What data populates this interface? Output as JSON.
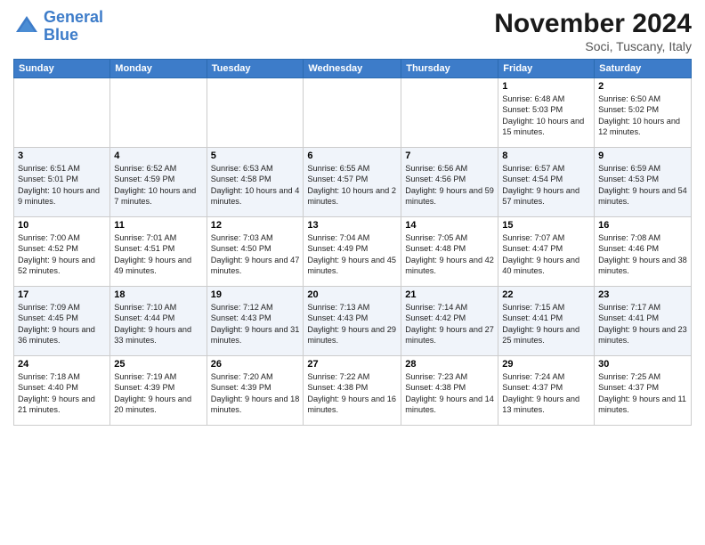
{
  "header": {
    "logo_line1": "General",
    "logo_line2": "Blue",
    "month_title": "November 2024",
    "subtitle": "Soci, Tuscany, Italy"
  },
  "days_of_week": [
    "Sunday",
    "Monday",
    "Tuesday",
    "Wednesday",
    "Thursday",
    "Friday",
    "Saturday"
  ],
  "weeks": [
    [
      {
        "day": "",
        "info": ""
      },
      {
        "day": "",
        "info": ""
      },
      {
        "day": "",
        "info": ""
      },
      {
        "day": "",
        "info": ""
      },
      {
        "day": "",
        "info": ""
      },
      {
        "day": "1",
        "info": "Sunrise: 6:48 AM\nSunset: 5:03 PM\nDaylight: 10 hours and 15 minutes."
      },
      {
        "day": "2",
        "info": "Sunrise: 6:50 AM\nSunset: 5:02 PM\nDaylight: 10 hours and 12 minutes."
      }
    ],
    [
      {
        "day": "3",
        "info": "Sunrise: 6:51 AM\nSunset: 5:01 PM\nDaylight: 10 hours and 9 minutes."
      },
      {
        "day": "4",
        "info": "Sunrise: 6:52 AM\nSunset: 4:59 PM\nDaylight: 10 hours and 7 minutes."
      },
      {
        "day": "5",
        "info": "Sunrise: 6:53 AM\nSunset: 4:58 PM\nDaylight: 10 hours and 4 minutes."
      },
      {
        "day": "6",
        "info": "Sunrise: 6:55 AM\nSunset: 4:57 PM\nDaylight: 10 hours and 2 minutes."
      },
      {
        "day": "7",
        "info": "Sunrise: 6:56 AM\nSunset: 4:56 PM\nDaylight: 9 hours and 59 minutes."
      },
      {
        "day": "8",
        "info": "Sunrise: 6:57 AM\nSunset: 4:54 PM\nDaylight: 9 hours and 57 minutes."
      },
      {
        "day": "9",
        "info": "Sunrise: 6:59 AM\nSunset: 4:53 PM\nDaylight: 9 hours and 54 minutes."
      }
    ],
    [
      {
        "day": "10",
        "info": "Sunrise: 7:00 AM\nSunset: 4:52 PM\nDaylight: 9 hours and 52 minutes."
      },
      {
        "day": "11",
        "info": "Sunrise: 7:01 AM\nSunset: 4:51 PM\nDaylight: 9 hours and 49 minutes."
      },
      {
        "day": "12",
        "info": "Sunrise: 7:03 AM\nSunset: 4:50 PM\nDaylight: 9 hours and 47 minutes."
      },
      {
        "day": "13",
        "info": "Sunrise: 7:04 AM\nSunset: 4:49 PM\nDaylight: 9 hours and 45 minutes."
      },
      {
        "day": "14",
        "info": "Sunrise: 7:05 AM\nSunset: 4:48 PM\nDaylight: 9 hours and 42 minutes."
      },
      {
        "day": "15",
        "info": "Sunrise: 7:07 AM\nSunset: 4:47 PM\nDaylight: 9 hours and 40 minutes."
      },
      {
        "day": "16",
        "info": "Sunrise: 7:08 AM\nSunset: 4:46 PM\nDaylight: 9 hours and 38 minutes."
      }
    ],
    [
      {
        "day": "17",
        "info": "Sunrise: 7:09 AM\nSunset: 4:45 PM\nDaylight: 9 hours and 36 minutes."
      },
      {
        "day": "18",
        "info": "Sunrise: 7:10 AM\nSunset: 4:44 PM\nDaylight: 9 hours and 33 minutes."
      },
      {
        "day": "19",
        "info": "Sunrise: 7:12 AM\nSunset: 4:43 PM\nDaylight: 9 hours and 31 minutes."
      },
      {
        "day": "20",
        "info": "Sunrise: 7:13 AM\nSunset: 4:43 PM\nDaylight: 9 hours and 29 minutes."
      },
      {
        "day": "21",
        "info": "Sunrise: 7:14 AM\nSunset: 4:42 PM\nDaylight: 9 hours and 27 minutes."
      },
      {
        "day": "22",
        "info": "Sunrise: 7:15 AM\nSunset: 4:41 PM\nDaylight: 9 hours and 25 minutes."
      },
      {
        "day": "23",
        "info": "Sunrise: 7:17 AM\nSunset: 4:41 PM\nDaylight: 9 hours and 23 minutes."
      }
    ],
    [
      {
        "day": "24",
        "info": "Sunrise: 7:18 AM\nSunset: 4:40 PM\nDaylight: 9 hours and 21 minutes."
      },
      {
        "day": "25",
        "info": "Sunrise: 7:19 AM\nSunset: 4:39 PM\nDaylight: 9 hours and 20 minutes."
      },
      {
        "day": "26",
        "info": "Sunrise: 7:20 AM\nSunset: 4:39 PM\nDaylight: 9 hours and 18 minutes."
      },
      {
        "day": "27",
        "info": "Sunrise: 7:22 AM\nSunset: 4:38 PM\nDaylight: 9 hours and 16 minutes."
      },
      {
        "day": "28",
        "info": "Sunrise: 7:23 AM\nSunset: 4:38 PM\nDaylight: 9 hours and 14 minutes."
      },
      {
        "day": "29",
        "info": "Sunrise: 7:24 AM\nSunset: 4:37 PM\nDaylight: 9 hours and 13 minutes."
      },
      {
        "day": "30",
        "info": "Sunrise: 7:25 AM\nSunset: 4:37 PM\nDaylight: 9 hours and 11 minutes."
      }
    ]
  ]
}
